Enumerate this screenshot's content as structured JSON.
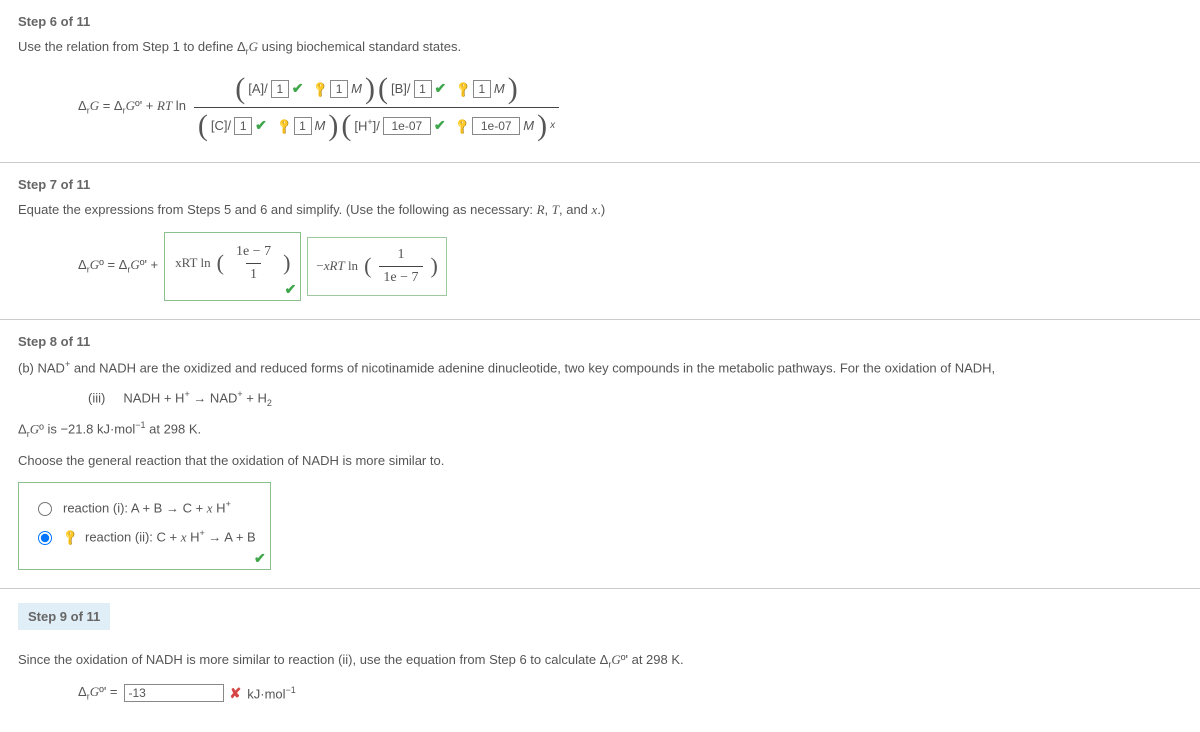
{
  "step6": {
    "header": "Step 6 of 11",
    "instruction": "Use the relation from Step 1 to define ΔrG using biochemical standard states.",
    "lhs": "ΔrG = ΔrGº' + RT ln",
    "num_A_label": "[A]/",
    "num_A_val": "1",
    "num_A_key": "1",
    "num_A_unit": "M",
    "num_B_label": "[B]/",
    "num_B_val": "1",
    "num_B_key": "1",
    "num_B_unit": "M",
    "den_C_label": "[C]/",
    "den_C_val": "1",
    "den_C_key": "1",
    "den_C_unit": "M",
    "den_H_label": "[H+]/",
    "den_H_val": "1e-07",
    "den_H_key": "1e-07",
    "den_H_unit": "M",
    "exp": "x"
  },
  "step7": {
    "header": "Step 7 of 11",
    "instruction": "Equate the expressions from Steps 5 and 6 and simplify. (Use the following as necessary: R, T, and x.)",
    "lhs": "ΔrGº = ΔrGº' +",
    "ans1_pre": "xRT ln",
    "ans1_num": "1e − 7",
    "ans1_den": "1",
    "ans2_pre": "−xRT ln",
    "ans2_num": "1",
    "ans2_den": "1e − 7"
  },
  "step8": {
    "header": "Step 8 of 11",
    "intro": "(b) NAD+ and NADH are the oxidized and reduced forms of nicotinamide adenine dinucleotide, two key compounds in the metabolic pathways. For the oxidation of NADH,",
    "eq_label": "(iii)",
    "eq": "NADH + H+ → NAD+ + H2",
    "dg": "ΔrGº is −21.8 kJ·mol−1 at 298 K.",
    "choose": "Choose the general reaction that the oxidation of NADH is more similar to.",
    "opt1": "reaction (i): A + B → C + x H+",
    "opt2": "reaction (ii): C + x H+ → A + B"
  },
  "step9": {
    "header": "Step 9 of 11",
    "instruction": "Since the oxidation of NADH is more similar to reaction (ii), use the equation from Step 6 to calculate ΔrGº' at 298 K.",
    "lhs": "ΔrGº' =",
    "val": "-13",
    "unit": "kJ·mol−1"
  }
}
